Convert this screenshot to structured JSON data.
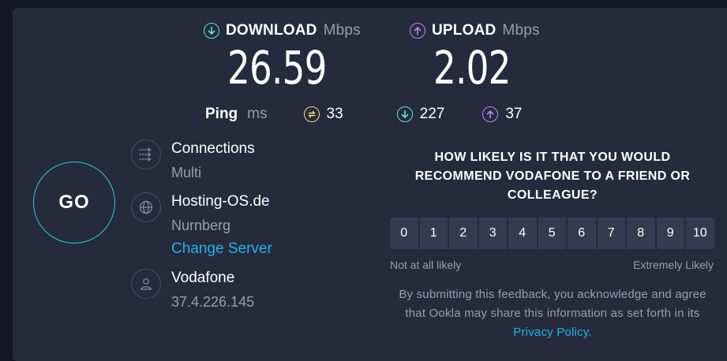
{
  "download": {
    "label": "DOWNLOAD",
    "unit": "Mbps",
    "value": "26.59",
    "icon": "arrow-down-circle-icon",
    "color": "#5de6d2"
  },
  "upload": {
    "label": "UPLOAD",
    "unit": "Mbps",
    "value": "2.02",
    "icon": "arrow-up-circle-icon",
    "color": "#b987f2"
  },
  "ping": {
    "label": "Ping",
    "unit": "ms",
    "idle": {
      "value": "33",
      "icon": "ping-idle-icon",
      "color": "#f2dc73"
    },
    "download": {
      "value": "227",
      "icon": "arrow-down-circle-icon",
      "color": "#5de6d2"
    },
    "upload": {
      "value": "37",
      "icon": "arrow-up-circle-icon",
      "color": "#b987f2"
    }
  },
  "go_button": {
    "label": "GO",
    "ring_color": "#1fd0e0"
  },
  "connections": {
    "title": "Connections",
    "value": "Multi",
    "icon": "connections-icon"
  },
  "server": {
    "title": "Hosting-OS.de",
    "location": "Nurnberg",
    "change_link": "Change Server",
    "icon": "globe-icon"
  },
  "provider": {
    "title": "Vodafone",
    "ip": "37.4.226.145",
    "icon": "user-icon"
  },
  "survey": {
    "question": "HOW LIKELY IS IT THAT YOU WOULD RECOMMEND VODAFONE TO A FRIEND OR COLLEAGUE?",
    "scale": [
      "0",
      "1",
      "2",
      "3",
      "4",
      "5",
      "6",
      "7",
      "8",
      "9",
      "10"
    ],
    "low_label": "Not at all likely",
    "high_label": "Extremely Likely",
    "disclaimer": "By submitting this feedback, you acknowledge and agree that Ookla may share this information as set forth in its",
    "privacy_link": "Privacy Policy",
    "period": "."
  }
}
